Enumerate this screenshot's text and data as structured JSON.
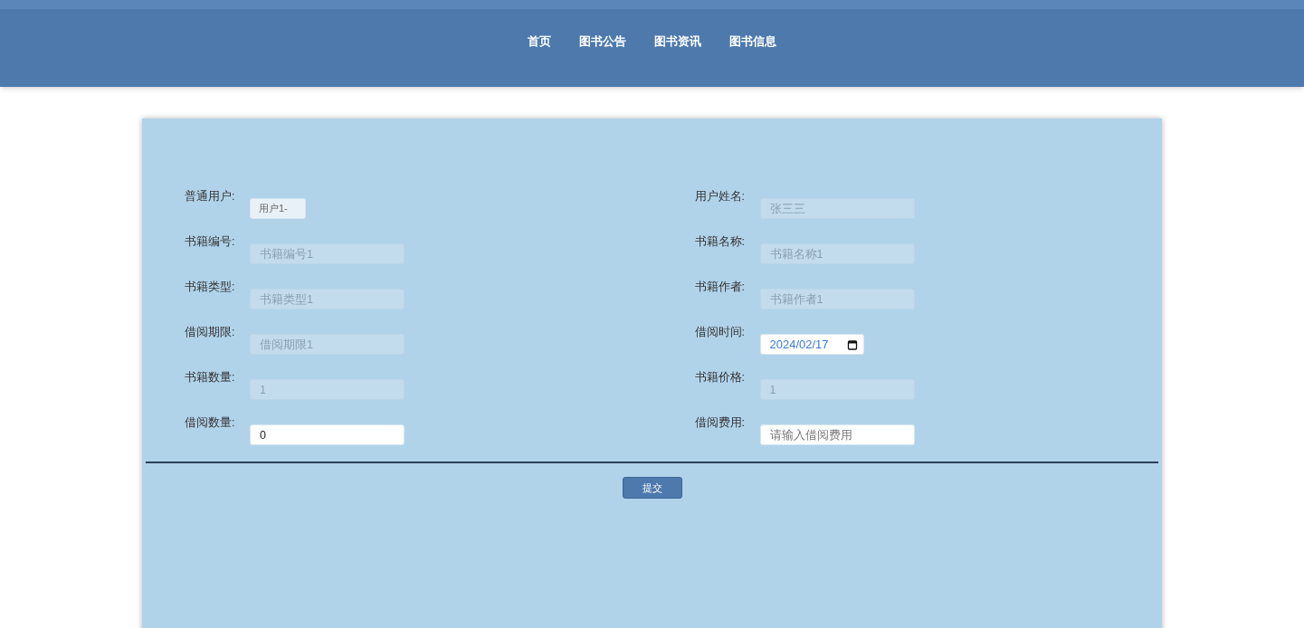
{
  "nav": {
    "items": [
      {
        "label": "首页"
      },
      {
        "label": "图书公告"
      },
      {
        "label": "图书资讯"
      },
      {
        "label": "图书信息"
      }
    ]
  },
  "form": {
    "fields": [
      {
        "label": "普通用户:",
        "kind": "select",
        "value": "用户1-",
        "disabled": false
      },
      {
        "label": "用户姓名:",
        "kind": "text",
        "placeholder": "张三三",
        "disabled": true
      },
      {
        "label": "书籍编号:",
        "kind": "text",
        "placeholder": "书籍编号1",
        "disabled": true
      },
      {
        "label": "书籍名称:",
        "kind": "text",
        "placeholder": "书籍名称1",
        "disabled": true
      },
      {
        "label": "书籍类型:",
        "kind": "text",
        "placeholder": "书籍类型1",
        "disabled": true
      },
      {
        "label": "书籍作者:",
        "kind": "text",
        "placeholder": "书籍作者1",
        "disabled": true
      },
      {
        "label": "借阅期限:",
        "kind": "text",
        "placeholder": "借阅期限1",
        "disabled": true
      },
      {
        "label": "借阅时间:",
        "kind": "date",
        "value": "2024/02/17",
        "disabled": false
      },
      {
        "label": "书籍数量:",
        "kind": "text",
        "placeholder": "1",
        "disabled": true
      },
      {
        "label": "书籍价格:",
        "kind": "text",
        "placeholder": "1",
        "disabled": true
      },
      {
        "label": "借阅数量:",
        "kind": "text",
        "value": "0",
        "disabled": false
      },
      {
        "label": "借阅费用:",
        "kind": "text",
        "placeholder": "请输入借阅费用",
        "disabled": false
      }
    ],
    "submit": "提交"
  }
}
